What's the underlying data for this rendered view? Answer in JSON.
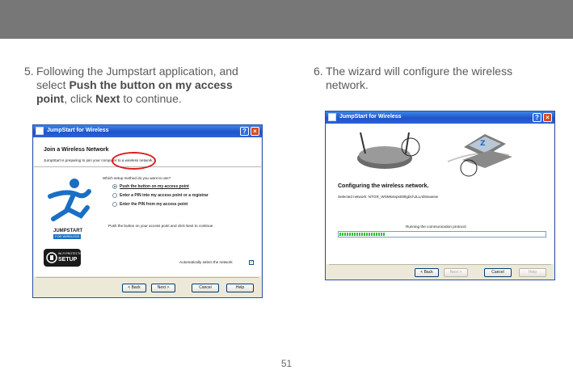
{
  "steps": [
    {
      "num": "5.",
      "pre": "Following the Jumpstart application, and select ",
      "b1": "Push the button on my access point",
      "mid": ", click ",
      "b2": "Next",
      "post": " to continue."
    },
    {
      "num": "6.",
      "text": "The wizard will configure the wireless network."
    }
  ],
  "page_number": "51",
  "dialog1": {
    "title": "JumpStart for Wireless",
    "heading": "Join a Wireless Network",
    "intro": "JumpStart is preparing to join your computer to a wireless network.",
    "question": "Which setup method do you want to use?",
    "options": [
      {
        "label": "Push the button on my access point",
        "selected": true
      },
      {
        "label": "Enter a PIN into my access point or a registrar",
        "selected": false
      },
      {
        "label": "Enter the PIN from my access point",
        "selected": false
      }
    ],
    "instruction": "Push the button on your access point and click Next to continue.",
    "auto_select_label": "Automatically select the network",
    "auto_select_checked": true,
    "logo_top": "JUMPSTART",
    "logo_bottom": "FOR WIRELESS",
    "wps_top": "WI-FI PROTECTED",
    "wps_bottom": "SETUP",
    "buttons": {
      "back": "< Back",
      "next": "Next >",
      "cancel": "Cancel",
      "help": "Help"
    }
  },
  "dialog2": {
    "title": "JumpStart for Wireless",
    "heading": "Configuring the wireless network.",
    "selected_network": "Selected network: NTGR_WSMk4epst00lgDchJLLnD8xaeew",
    "status": "Running the communication protocol",
    "progress_fraction": 0.22,
    "buttons": {
      "back": "< Back",
      "next": "Next >",
      "cancel": "Cancel",
      "help": "Help"
    }
  },
  "colors": {
    "titlebar": "#1f54c9",
    "dialog_face": "#ece9d8",
    "highlight_ring": "#d91c1c",
    "top_band": "#777777"
  }
}
